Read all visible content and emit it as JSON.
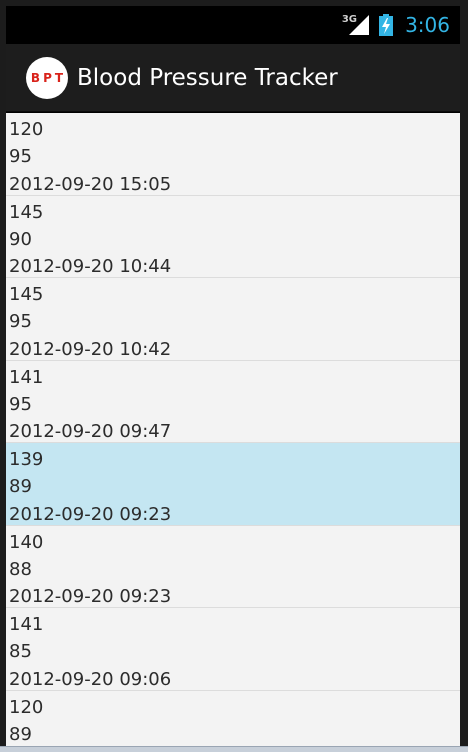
{
  "status_bar": {
    "network": "3G",
    "time": "3:06",
    "icons": [
      "signal-icon",
      "battery-charging-icon"
    ],
    "colors": {
      "time": "#33b5e5",
      "background": "#000000"
    }
  },
  "action_bar": {
    "logo_text": "BPT",
    "title": "Blood Pressure Tracker",
    "colors": {
      "background": "#1d1d1d",
      "logo_text": "#d9231b"
    }
  },
  "list": {
    "selected_index": 4,
    "colors": {
      "background": "#f3f3f3",
      "selected": "#c4e6f2",
      "divider": "#dcdcdc"
    },
    "entries": [
      {
        "systolic": "120",
        "diastolic": "95",
        "timestamp": "2012-09-20 15:05"
      },
      {
        "systolic": "145",
        "diastolic": "90",
        "timestamp": "2012-09-20 10:44"
      },
      {
        "systolic": "145",
        "diastolic": "95",
        "timestamp": "2012-09-20 10:42"
      },
      {
        "systolic": "141",
        "diastolic": "95",
        "timestamp": "2012-09-20 09:47"
      },
      {
        "systolic": "139",
        "diastolic": "89",
        "timestamp": "2012-09-20 09:23"
      },
      {
        "systolic": "140",
        "diastolic": "88",
        "timestamp": "2012-09-20 09:23"
      },
      {
        "systolic": "141",
        "diastolic": "85",
        "timestamp": "2012-09-20 09:06"
      },
      {
        "systolic": "120",
        "diastolic": "89",
        "timestamp": ""
      }
    ]
  }
}
